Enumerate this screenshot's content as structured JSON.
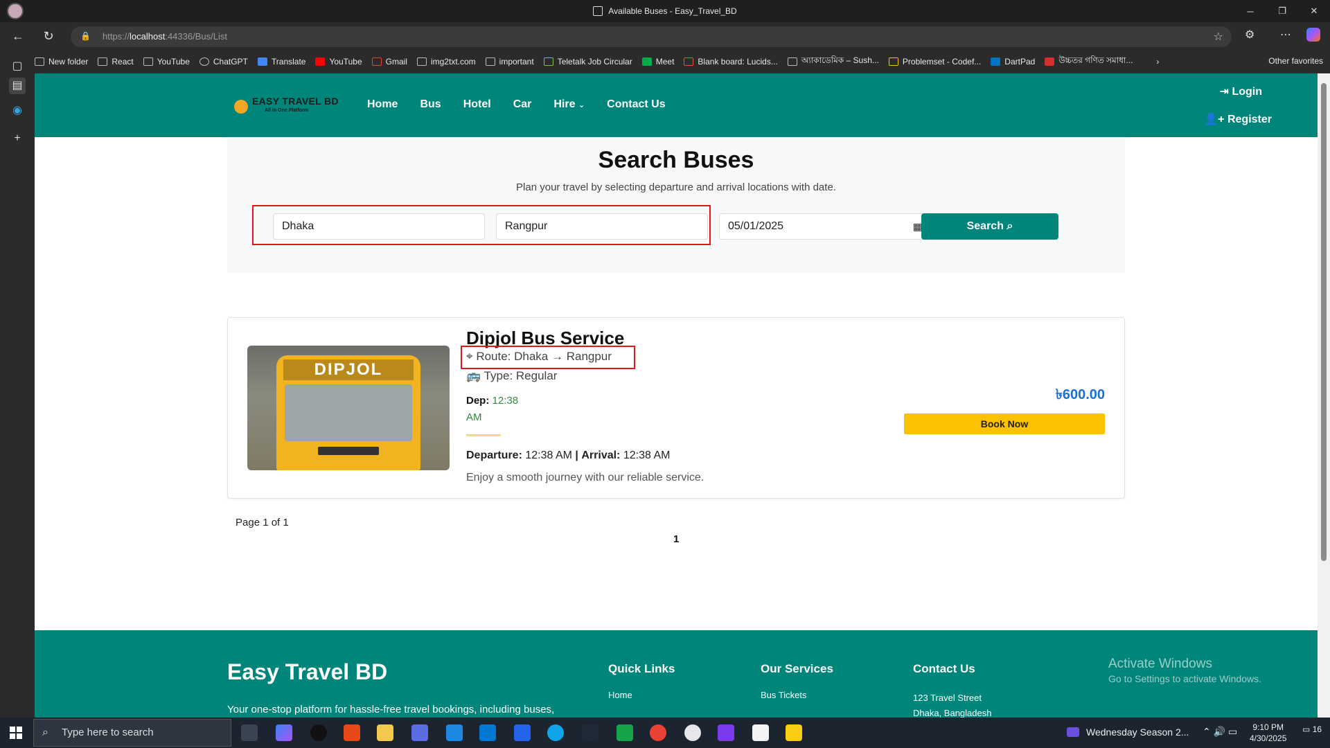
{
  "window": {
    "title": "Available Buses - Easy_Travel_BD",
    "min": "─",
    "max": "❐",
    "close": "✕"
  },
  "address": {
    "scheme": "https://",
    "host": "localhost",
    "path": ":44336/Bus/List"
  },
  "bookmarks": {
    "items": [
      "New folder",
      "React",
      "YouTube",
      "ChatGPT",
      "Translate",
      "YouTube",
      "Gmail",
      "img2txt.com",
      "important",
      "Teletalk Job Circular",
      "Meet",
      "Blank board: Lucids...",
      "অ্যাকাডেমিক – Sush...",
      "Problemset - Codef...",
      "DartPad",
      "উচ্চতর গণিত সমাধা..."
    ],
    "other": "Other favorites"
  },
  "header": {
    "brand": "EASY TRAVEL BD",
    "tagline": "All in One Platform",
    "nav": [
      "Home",
      "Bus",
      "Hotel",
      "Car",
      "Hire",
      "Contact Us"
    ],
    "login": "Login",
    "register": "Register"
  },
  "search": {
    "title": "Search Buses",
    "subtitle": "Plan your travel by selecting departure and arrival locations with date.",
    "from": "Dhaka",
    "to": "Rangpur",
    "date": "05/01/2025",
    "button": "Search"
  },
  "bus": {
    "image_text": "DIPJOL",
    "name": "Dipjol Bus Service",
    "route": "Route: Dhaka → Rangpur",
    "type": "Type: Regular",
    "dep_label": "Dep:",
    "dep_time": "12:38 AM",
    "departure_label": "Departure:",
    "departure_time": "12:38 AM",
    "separator": "|",
    "arrival_label": "Arrival:",
    "arrival_time": "12:38 AM",
    "description": "Enjoy a smooth journey with our reliable service.",
    "price": "৳600.00",
    "book_button": "Book Now"
  },
  "pagination": {
    "info": "Page 1 of 1",
    "current": "1"
  },
  "footer": {
    "brand": "Easy Travel BD",
    "description": "Your one-stop platform for hassle-free travel bookings, including buses,",
    "quick_links": "Quick Links",
    "home": "Home",
    "services": "Our Services",
    "bus_tickets": "Bus Tickets",
    "contact": "Contact Us",
    "address": "123 Travel Street",
    "address2": "Dhaka, Bangladesh"
  },
  "watermark": {
    "line1": "Activate Windows",
    "line2": "Go to Settings to activate Windows."
  },
  "taskbar": {
    "search_placeholder": "Type here to search",
    "news": "Wednesday Season 2...",
    "time": "9:10 PM",
    "date": "4/30/2025",
    "notifications": "16"
  },
  "colors": {
    "brand_teal": "#00857a",
    "accent_yellow": "#fcc200",
    "price_blue": "#1a6fd8",
    "highlight_red": "#e0161b"
  }
}
